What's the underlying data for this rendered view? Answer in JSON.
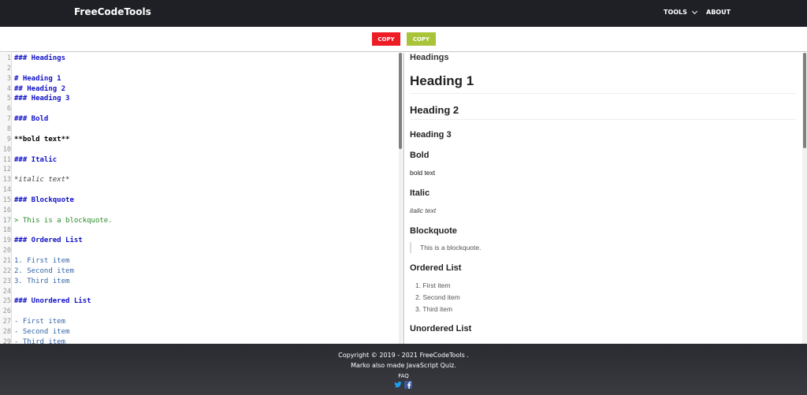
{
  "navbar": {
    "brand": "FreeCodeTools",
    "tools_label": "TOOLS",
    "about_label": "ABOUT"
  },
  "toolbar": {
    "copy_markdown_label": "COPY",
    "copy_html_label": "COPY",
    "copy_markdown_color": "#ee1c25",
    "copy_html_color": "#a9c43a"
  },
  "editor": {
    "lines": [
      {
        "n": "1",
        "text": "### Headings",
        "kind": "h"
      },
      {
        "n": "2",
        "text": "",
        "kind": ""
      },
      {
        "n": "3",
        "text": "# Heading 1",
        "kind": "h"
      },
      {
        "n": "4",
        "text": "## Heading 2",
        "kind": "h"
      },
      {
        "n": "5",
        "text": "### Heading 3",
        "kind": "h"
      },
      {
        "n": "6",
        "text": "",
        "kind": ""
      },
      {
        "n": "7",
        "text": "### Bold",
        "kind": "h"
      },
      {
        "n": "8",
        "text": "",
        "kind": ""
      },
      {
        "n": "9",
        "text": "**bold text**",
        "kind": "b"
      },
      {
        "n": "10",
        "text": "",
        "kind": ""
      },
      {
        "n": "11",
        "text": "### Italic",
        "kind": "h"
      },
      {
        "n": "12",
        "text": "",
        "kind": ""
      },
      {
        "n": "13",
        "text": "*italic text*",
        "kind": "i"
      },
      {
        "n": "14",
        "text": "",
        "kind": ""
      },
      {
        "n": "15",
        "text": "### Blockquote",
        "kind": "h"
      },
      {
        "n": "16",
        "text": "",
        "kind": ""
      },
      {
        "n": "17",
        "text": "> This is a blockquote.",
        "kind": "q"
      },
      {
        "n": "18",
        "text": "",
        "kind": ""
      },
      {
        "n": "19",
        "text": "### Ordered List",
        "kind": "h"
      },
      {
        "n": "20",
        "text": "",
        "kind": ""
      },
      {
        "n": "21",
        "text": "1. First item",
        "kind": "l"
      },
      {
        "n": "22",
        "text": "2. Second item",
        "kind": "l"
      },
      {
        "n": "23",
        "text": "3. Third item",
        "kind": "l"
      },
      {
        "n": "24",
        "text": "",
        "kind": ""
      },
      {
        "n": "25",
        "text": "### Unordered List",
        "kind": "h"
      },
      {
        "n": "26",
        "text": "",
        "kind": ""
      },
      {
        "n": "27",
        "text": "- First item",
        "kind": "l"
      },
      {
        "n": "28",
        "text": "- Second item",
        "kind": "l"
      },
      {
        "n": "29",
        "text": "- Third item",
        "kind": "l"
      }
    ]
  },
  "preview": {
    "headings_title": "Headings",
    "h1": "Heading 1",
    "h2": "Heading 2",
    "h3": "Heading 3",
    "bold_title": "Bold",
    "bold_text": "bold text",
    "italic_title": "Italic",
    "italic_text": "italic text",
    "blockquote_title": "Blockquote",
    "blockquote_text": "This is a blockquote.",
    "ordered_title": "Ordered List",
    "ordered_items": [
      "First item",
      "Second item",
      "Third item"
    ],
    "unordered_title": "Unordered List"
  },
  "footer": {
    "copyright": "Copyright © 2019 - 2021 FreeCodeTools .",
    "credit": "Marko also made JavaScript Quiz.",
    "faq": "FAQ",
    "social_icons": [
      "twitter-icon",
      "facebook-icon"
    ]
  }
}
